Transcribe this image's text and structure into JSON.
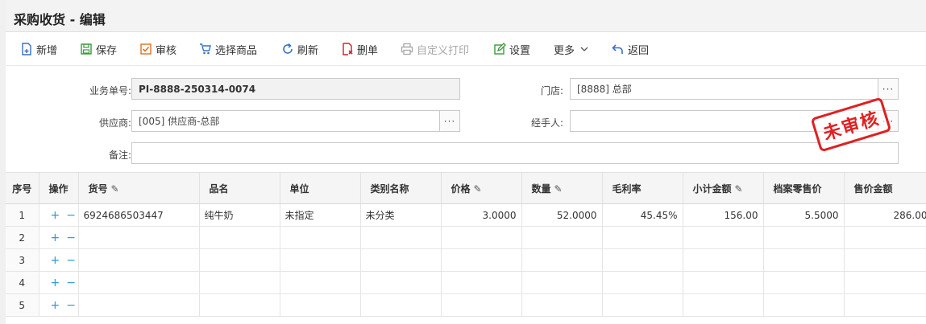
{
  "window": {
    "title": "采购收货 - 编辑"
  },
  "toolbar": [
    {
      "label": "新增",
      "icon": "new-doc-icon",
      "color": "#3a6fc4",
      "disabled": false
    },
    {
      "label": "保存",
      "icon": "save-icon",
      "color": "#3a9a3a",
      "disabled": false
    },
    {
      "label": "审核",
      "icon": "audit-icon",
      "color": "#e07020",
      "disabled": false
    },
    {
      "label": "选择商品",
      "icon": "cart-icon",
      "color": "#3a6fc4",
      "disabled": false
    },
    {
      "label": "刷新",
      "icon": "refresh-icon",
      "color": "#3a6fc4",
      "disabled": false
    },
    {
      "label": "删单",
      "icon": "delete-doc-icon",
      "color": "#d02020",
      "disabled": false
    },
    {
      "label": "自定义打印",
      "icon": "print-icon",
      "color": "#a8a8a8",
      "disabled": true
    },
    {
      "label": "设置",
      "icon": "settings-icon",
      "color": "#3a9a3a",
      "disabled": false
    },
    {
      "label": "更多",
      "icon": "chevron-down-icon",
      "color": "#555555",
      "disabled": false
    },
    {
      "label": "返回",
      "icon": "back-icon",
      "color": "#3a6fc4",
      "disabled": false
    }
  ],
  "form": {
    "order_no_label": "业务单号:",
    "order_no": "PI-8888-250314-0074",
    "store_label": "门店:",
    "store": "[8888] 总部",
    "supplier_label": "供应商:",
    "supplier": "[005] 供应商-总部",
    "handler_label": "经手人:",
    "handler": "",
    "remark_label": "备注:",
    "remark": "",
    "dots": "···"
  },
  "stamp": {
    "text": "未审核",
    "color": "#e02020"
  },
  "grid": {
    "columns": [
      "序号",
      "操作",
      "货号",
      "品名",
      "单位",
      "类别名称",
      "价格",
      "数量",
      "毛利率",
      "小计金额",
      "档案零售价",
      "售价金额"
    ],
    "rows": [
      {
        "index": "1",
        "code": "6924686503447",
        "name": "纯牛奶",
        "unit": "未指定",
        "category": "未分类",
        "price": "3.0000",
        "qty": "52.0000",
        "margin": "45.45%",
        "subtotal": "156.00",
        "retail": "5.5000",
        "amount": "286.00"
      },
      {
        "index": "2",
        "code": "",
        "name": "",
        "unit": "",
        "category": "",
        "price": "",
        "qty": "",
        "margin": "",
        "subtotal": "",
        "retail": "",
        "amount": ""
      },
      {
        "index": "3",
        "code": "",
        "name": "",
        "unit": "",
        "category": "",
        "price": "",
        "qty": "",
        "margin": "",
        "subtotal": "",
        "retail": "",
        "amount": ""
      },
      {
        "index": "4",
        "code": "",
        "name": "",
        "unit": "",
        "category": "",
        "price": "",
        "qty": "",
        "margin": "",
        "subtotal": "",
        "retail": "",
        "amount": ""
      },
      {
        "index": "5",
        "code": "",
        "name": "",
        "unit": "",
        "category": "",
        "price": "",
        "qty": "",
        "margin": "",
        "subtotal": "",
        "retail": "",
        "amount": ""
      }
    ],
    "add_symbol": "+",
    "remove_symbol": "−",
    "edit_symbol": "✎"
  }
}
